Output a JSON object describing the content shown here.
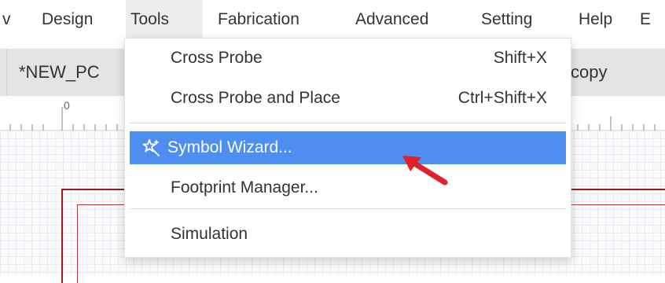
{
  "menubar": {
    "items": [
      "v",
      "Design",
      "Tools",
      "Fabrication",
      "Advanced",
      "Setting",
      "Help",
      "E"
    ],
    "active": "Tools"
  },
  "tabs": {
    "left_label": "*NEW_PC",
    "right_label": "copy"
  },
  "ruler": {
    "zero_label": "0"
  },
  "tools_menu": {
    "items": [
      {
        "label": "Cross Probe",
        "shortcut": "Shift+X"
      },
      {
        "label": "Cross Probe and Place",
        "shortcut": "Ctrl+Shift+X"
      },
      {
        "label": "Symbol Wizard...",
        "icon": "magic-wand-icon",
        "highlighted": true
      },
      {
        "label": "Footprint Manager..."
      },
      {
        "label": "Simulation"
      }
    ]
  },
  "colors": {
    "highlight": "#4d8ef0",
    "board_outline": "#9b1c1c",
    "annotation_arrow": "#e0202a"
  }
}
